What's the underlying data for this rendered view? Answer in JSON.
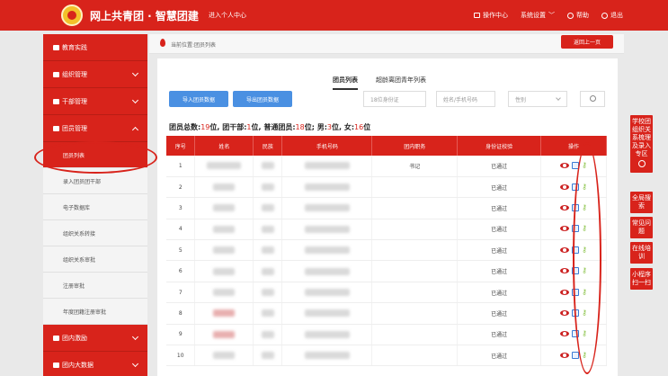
{
  "header": {
    "brand": "网上共青团 · 智慧团建",
    "subtitle": "进入个人中心",
    "actions": [
      {
        "label": "操作中心",
        "icon": "mail-icon"
      },
      {
        "label": "系统设置",
        "icon": "chevron-down-icon"
      },
      {
        "label": "帮助",
        "icon": "help-icon"
      },
      {
        "label": "退出",
        "icon": "logout-icon"
      }
    ]
  },
  "sidebar": {
    "top_item": "教育实践",
    "groups": [
      {
        "label": "组织管理"
      },
      {
        "label": "干部管理"
      },
      {
        "label": "团员管理"
      }
    ],
    "sub_items": [
      {
        "label": "团员列表"
      },
      {
        "label": "录入团员团干部"
      },
      {
        "label": "电子数据库"
      },
      {
        "label": "组织关系转接"
      },
      {
        "label": "组织关系审批"
      },
      {
        "label": "注册审批"
      },
      {
        "label": "年度团籍注册审批"
      }
    ],
    "bottom_groups": [
      {
        "label": "团内激励"
      },
      {
        "label": "团内大数据"
      }
    ]
  },
  "breadcrumb": {
    "text": "当前位置:团员列表",
    "back_label": "返回上一页"
  },
  "tabs": [
    {
      "label": "团员列表",
      "active": true
    },
    {
      "label": "超龄离团青年列表",
      "active": false
    }
  ],
  "toolbar": {
    "import_label": "导入团员数据",
    "export_label": "导出团员数据",
    "id_placeholder": "18位身份证",
    "name_placeholder": "姓名/手机号码",
    "gender_label": "性别"
  },
  "summary": {
    "total_label": "团员总数:",
    "total": "19",
    "cadre_label": "位,  团干部:",
    "cadre": "1",
    "normal_label": "位,  普通团员:",
    "normal": "18",
    "male_label": "位;  男:",
    "male": "3",
    "female_label": "位,  女:",
    "female": "16",
    "unit_end": "位"
  },
  "table": {
    "headers": [
      "序号",
      "姓名",
      "民族",
      "手机号码",
      "团内职务",
      "身份证校验",
      "操作"
    ],
    "rows": [
      {
        "no": "1",
        "role": "书记",
        "check": "已通过"
      },
      {
        "no": "2",
        "role": "",
        "check": "已通过"
      },
      {
        "no": "3",
        "role": "",
        "check": "已通过"
      },
      {
        "no": "4",
        "role": "",
        "check": "已通过"
      },
      {
        "no": "5",
        "role": "",
        "check": "已通过"
      },
      {
        "no": "6",
        "role": "",
        "check": "已通过"
      },
      {
        "no": "7",
        "role": "",
        "check": "已通过"
      },
      {
        "no": "8",
        "role": "",
        "check": "已通过"
      },
      {
        "no": "9",
        "role": "",
        "check": "已通过"
      },
      {
        "no": "10",
        "role": "",
        "check": "已通过"
      }
    ]
  },
  "float_menu": [
    {
      "label": "学校团组织关系梳理及录入专区"
    },
    {
      "label": "全局搜索"
    },
    {
      "label": "常见问题"
    },
    {
      "label": "在线培训"
    },
    {
      "label": "小程序扫一扫"
    }
  ],
  "colors": {
    "brand_red": "#d8231b",
    "button_blue": "#4a90e2"
  }
}
